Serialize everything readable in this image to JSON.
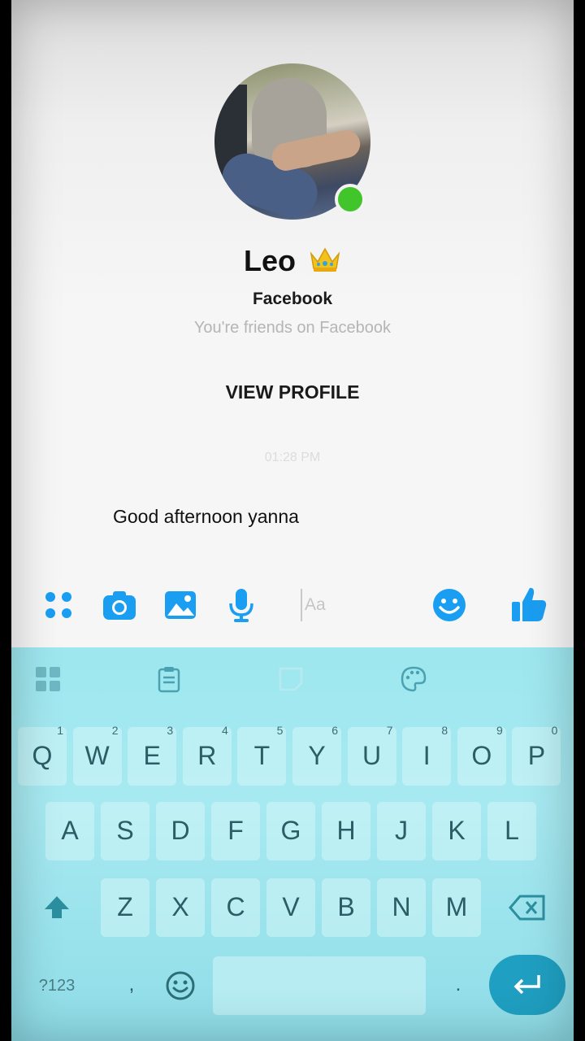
{
  "contact": {
    "name": "Leo",
    "platform": "Facebook",
    "relationship": "You're friends on Facebook",
    "online": true,
    "badge_icon": "crown-icon"
  },
  "actions": {
    "view_profile": "VIEW PROFILE"
  },
  "conversation": {
    "timestamp": "01:28 PM",
    "messages": [
      {
        "text": "Good afternoon yanna",
        "from": "contact"
      }
    ]
  },
  "composer": {
    "placeholder": "Aa",
    "icons": [
      "menu-grid-icon",
      "camera-icon",
      "gallery-icon",
      "microphone-icon",
      "emoji-icon",
      "thumbs-up-icon"
    ],
    "accent_color": "#1a9ef2"
  },
  "keyboard": {
    "toolbar_icons": [
      "apps-icon",
      "clipboard-icon",
      "sticker-icon",
      "palette-icon"
    ],
    "row1": [
      {
        "key": "Q",
        "hint": "1"
      },
      {
        "key": "W",
        "hint": "2"
      },
      {
        "key": "E",
        "hint": "3"
      },
      {
        "key": "R",
        "hint": "4"
      },
      {
        "key": "T",
        "hint": "5"
      },
      {
        "key": "Y",
        "hint": "6"
      },
      {
        "key": "U",
        "hint": "7"
      },
      {
        "key": "I",
        "hint": "8"
      },
      {
        "key": "O",
        "hint": "9"
      },
      {
        "key": "P",
        "hint": "0"
      }
    ],
    "row2": [
      "A",
      "S",
      "D",
      "F",
      "G",
      "H",
      "J",
      "K",
      "L"
    ],
    "row3": [
      "Z",
      "X",
      "C",
      "V",
      "B",
      "N",
      "M"
    ],
    "symbols_label": "?123",
    "comma": ",",
    "period": ".",
    "color": "#9ee7ef"
  }
}
